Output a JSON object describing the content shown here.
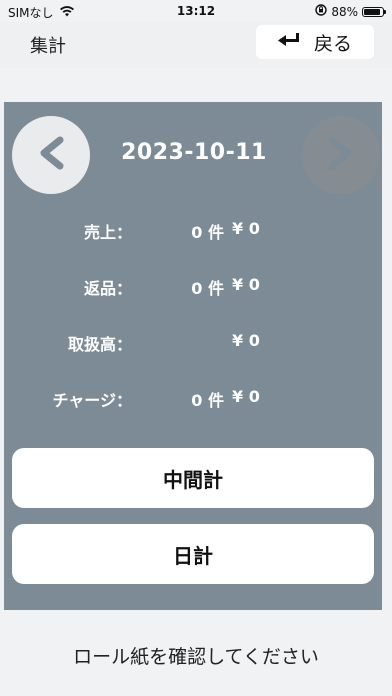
{
  "status_bar": {
    "carrier": "SIMなし",
    "time": "13:12",
    "battery": "88%",
    "battery_level": 0.88
  },
  "header": {
    "title": "集計",
    "back_label": "戻る"
  },
  "panel": {
    "date": "2023-10-11",
    "rows": [
      {
        "label": "売上：",
        "count": "0 件",
        "amount": "¥ 0"
      },
      {
        "label": "返品：",
        "count": "0 件",
        "amount": "¥ 0"
      },
      {
        "label": "取扱高：",
        "count": "",
        "amount": "¥ 0"
      },
      {
        "label": "チャージ：",
        "count": "0 件",
        "amount": "¥ 0"
      }
    ],
    "subtotal_label": "中間計",
    "daily_total_label": "日計"
  },
  "footer": {
    "message": "ロール紙を確認してください"
  },
  "colors": {
    "panel": "#7d8b96",
    "button": "#ffffff",
    "background": "#f1f2f4"
  }
}
